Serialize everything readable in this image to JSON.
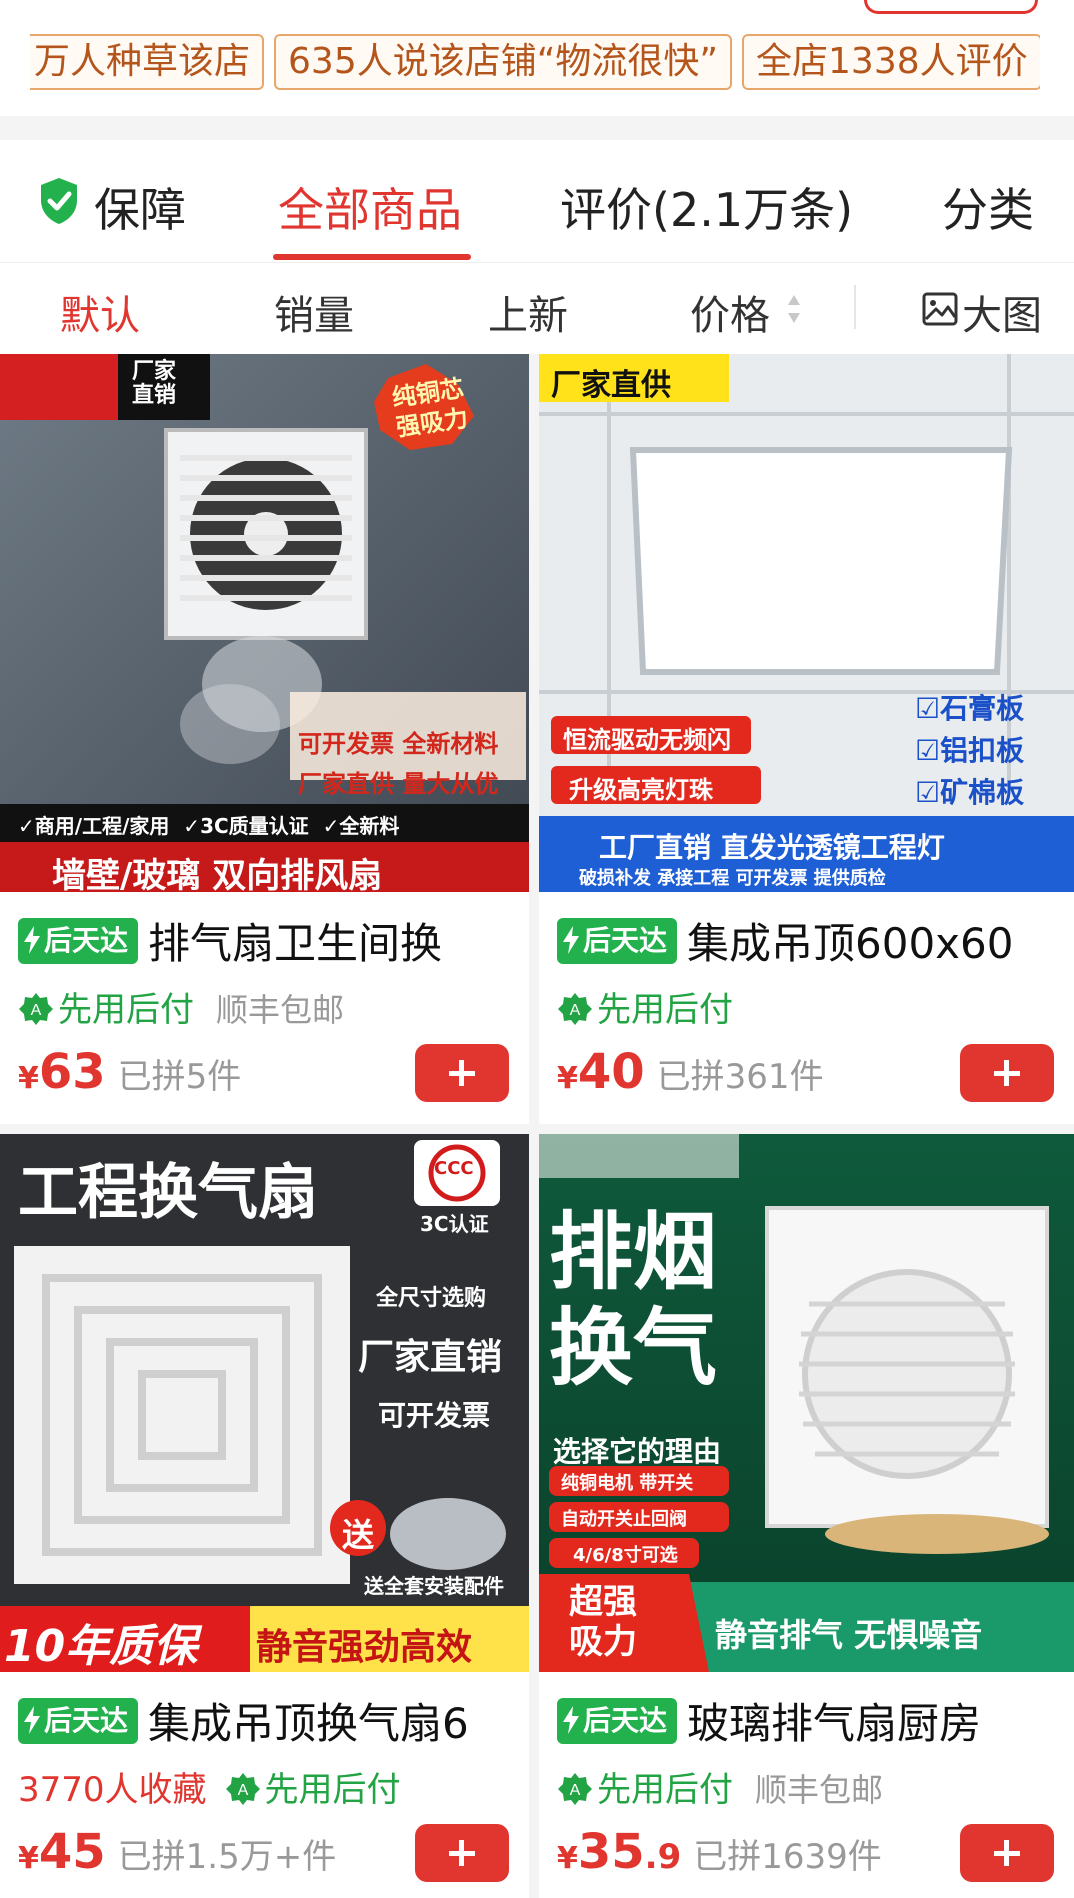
{
  "store_tags": [
    "万人种草该店",
    "635人说该店铺“物流很快”",
    "全店1338人评价"
  ],
  "tabs": {
    "guarantee": "保障",
    "all_products": "全部商品",
    "reviews": "评价(2.1万条)",
    "category": "分类"
  },
  "sort": {
    "default": "默认",
    "sales": "销量",
    "new": "上新",
    "price": "价格",
    "big_image": "大图"
  },
  "products": [
    {
      "badge": "后天达",
      "title": "排气扇卫生间换",
      "pay": "先用后付",
      "shipping": "顺丰包邮",
      "price": "63",
      "sold": "已拼5件",
      "image": {
        "corner": [
          "厂家",
          "直销"
        ],
        "stamp": [
          "纯铜芯",
          "强吸力"
        ],
        "promo": [
          "可开发票  全新材料",
          "厂家直供  量大从优"
        ],
        "checks": [
          "商用/工程/家用",
          "3C质量认证",
          "全新料"
        ],
        "banner": "墙壁/玻璃 双向排风扇"
      }
    },
    {
      "badge": "后天达",
      "title": "集成吊顶600x60",
      "pay": "先用后付",
      "price": "40",
      "sold": "已拼361件",
      "image": {
        "corner": "厂家直供",
        "features": [
          "恒流驱动无频闪",
          "升级高亮灯珠"
        ],
        "checks": [
          "石膏板",
          "铝扣板",
          "矿棉板"
        ],
        "banner": "工厂直销 直发光透镜工程灯",
        "banner_sub": "破损补发    承接工程    可开发票    提供质检"
      }
    },
    {
      "badge": "后天达",
      "title": "集成吊顶换气扇6",
      "favorites": "3770人收藏",
      "pay": "先用后付",
      "price": "45",
      "sold": "已拼1.5万+件",
      "image": {
        "headline": "工程换气扇",
        "cert": "3C认证",
        "cert_mark": "CCC",
        "features": [
          "全尺寸选购",
          "厂家直销",
          "可开发票"
        ],
        "gift": "送",
        "gift_note": "送全套安装配件",
        "banner_left": "10年质保",
        "banner_right": "静音强劲高效"
      }
    },
    {
      "badge": "后天达",
      "title": "玻璃排气扇厨房",
      "pay": "先用后付",
      "shipping": "顺丰包邮",
      "price": "35",
      "price_decimal": ".9",
      "sold": "已拼1639件",
      "image": {
        "headline": [
          "排烟",
          "换气"
        ],
        "reason": "选择它的理由",
        "features": [
          "纯铜电机 带开关",
          "自动开关止回阀",
          "4/6/8寸可选"
        ],
        "banner_left": [
          "超强",
          "吸力"
        ],
        "banner_right": "静音排气  无惧噪音"
      }
    }
  ],
  "colors": {
    "accent": "#e0362f",
    "badge_green": "#22b14c",
    "tag_border": "#e8a76a"
  },
  "icons": [
    "shield-check-icon",
    "sort-arrows-icon",
    "image-icon",
    "bolt-icon",
    "pay-later-icon",
    "plus-icon"
  ]
}
